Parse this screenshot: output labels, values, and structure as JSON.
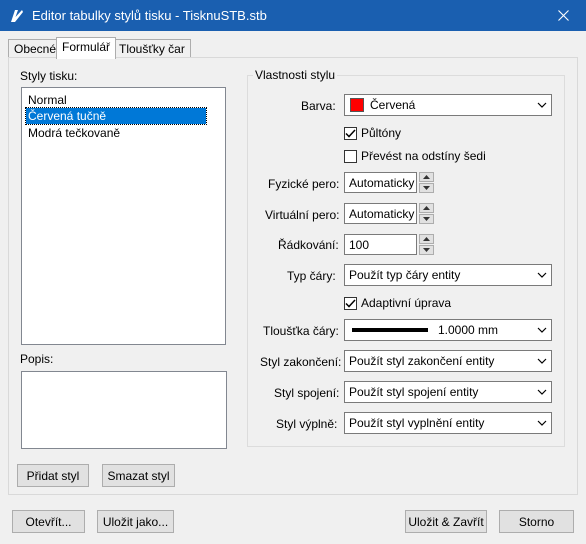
{
  "window": {
    "title": "Editor tabulky stylů tisku - TisknuSTB.stb"
  },
  "tabs": [
    {
      "label": "Obecné"
    },
    {
      "label": "Formulář"
    },
    {
      "label": "Tloušťky čar"
    }
  ],
  "styles_panel": {
    "label": "Styly tisku:",
    "items": [
      {
        "label": "Normal"
      },
      {
        "label": "Červená tučně"
      },
      {
        "label": "Modrá tečkovaně"
      }
    ],
    "description_label": "Popis:",
    "add_button": "Přidat styl",
    "delete_button": "Smazat styl"
  },
  "properties": {
    "group_title": "Vlastnosti stylu",
    "color": {
      "label": "Barva:",
      "value": "Červená",
      "swatch": "#ff0000"
    },
    "halftones": {
      "label": "Půltóny",
      "checked": true
    },
    "grayscale": {
      "label": "Převést na odstíny šedi",
      "checked": false
    },
    "physical_pen": {
      "label": "Fyzické pero:",
      "value": "Automaticky"
    },
    "virtual_pen": {
      "label": "Virtuální pero:",
      "value": "Automaticky"
    },
    "screening": {
      "label": "Řádkování:",
      "value": "100"
    },
    "linetype": {
      "label": "Typ čáry:",
      "value": "Použít typ čáry entity"
    },
    "adaptive": {
      "label": "Adaptivní úprava",
      "checked": true
    },
    "lineweight": {
      "label": "Tloušťka čáry:",
      "value": "1.0000 mm"
    },
    "line_end": {
      "label": "Styl zakončení:",
      "value": "Použít styl zakončení entity"
    },
    "line_join": {
      "label": "Styl spojení:",
      "value": "Použít styl spojení entity"
    },
    "fill": {
      "label": "Styl výplně:",
      "value": "Použít styl vyplnění entity"
    }
  },
  "footer": {
    "open_button": "Otevřít...",
    "save_as_button": "Uložit jako...",
    "save_close_button": "Uložit & Zavřít",
    "cancel_button": "Storno"
  }
}
